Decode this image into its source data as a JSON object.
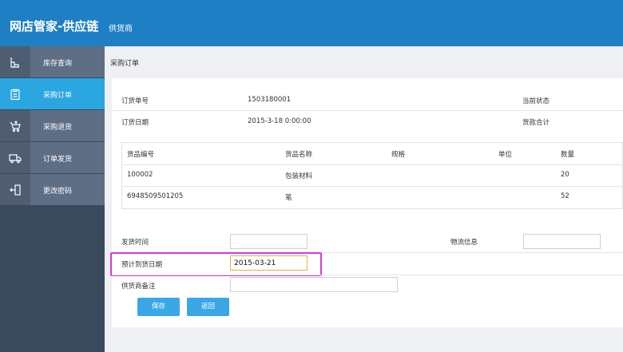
{
  "header": {
    "title": "网店管家-供应链",
    "subtitle": "供货商"
  },
  "sidebar": {
    "items": [
      {
        "label": "库存查询",
        "icon": "warehouse-icon"
      },
      {
        "label": "采购订单",
        "icon": "clipboard-icon",
        "active": true
      },
      {
        "label": "采购退货",
        "icon": "cart-return-icon"
      },
      {
        "label": "订单发货",
        "icon": "truck-icon"
      },
      {
        "label": "更改密码",
        "icon": "key-icon"
      }
    ]
  },
  "page": {
    "title": "采购订单"
  },
  "order": {
    "number_label": "订货单号",
    "number": "1503180001",
    "status_label": "当前状态",
    "date_label": "订货日期",
    "date": "2015-3-18 0:00:00",
    "total_label": "货款合计"
  },
  "items_table": {
    "headers": [
      "货品编号",
      "货品名称",
      "规格",
      "单位",
      "数量"
    ],
    "rows": [
      [
        "100002",
        "包装材料",
        "",
        "",
        "20"
      ],
      [
        "6948509501205",
        "笔",
        "",
        "",
        "52"
      ]
    ]
  },
  "form": {
    "ship_time_label": "发货时间",
    "ship_time_value": "",
    "logistics_label": "物流信息",
    "logistics_value": "",
    "eta_label": "预计到货日期",
    "eta_value": "2015-03-21",
    "note_label": "供货商备注",
    "note_value": "",
    "save_label": "保存",
    "back_label": "返回"
  },
  "colors": {
    "header": "#1f7fc4",
    "active_nav": "#2aa6e0",
    "highlight": "#d63ad6",
    "button": "#3aa7e6"
  }
}
